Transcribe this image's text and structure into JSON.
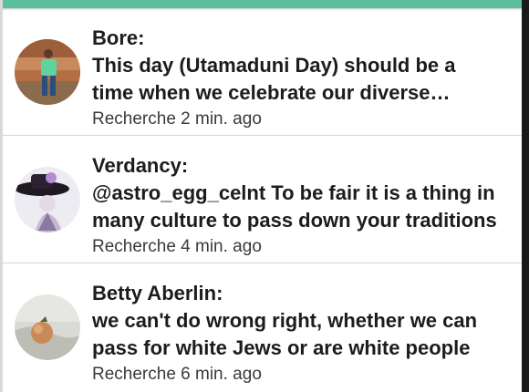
{
  "comments": [
    {
      "author": "Bore:",
      "text": "This day (Utamaduni Day) should be a time when we celebrate our diverse cultures and traditions together",
      "meta": "Recherche 2 min. ago",
      "avatar_icon": "user-photo-icon"
    },
    {
      "author": "Verdancy:",
      "text": "@astro_egg_celnt To be fair it is a thing in many culture to pass down your traditions",
      "meta": "Recherche 4 min. ago",
      "avatar_icon": "user-photo-icon"
    },
    {
      "author": "Betty Aberlin:",
      "text": "we can't do wrong right, whether we can pass for white Jews or are white people",
      "meta": "Recherche 6 min. ago",
      "avatar_icon": "user-photo-icon"
    }
  ],
  "colors": {
    "header_accent": "#5bbf9f",
    "text": "#1c1c1c",
    "meta_text": "#3a3a3a",
    "divider": "#d6d6d6"
  }
}
